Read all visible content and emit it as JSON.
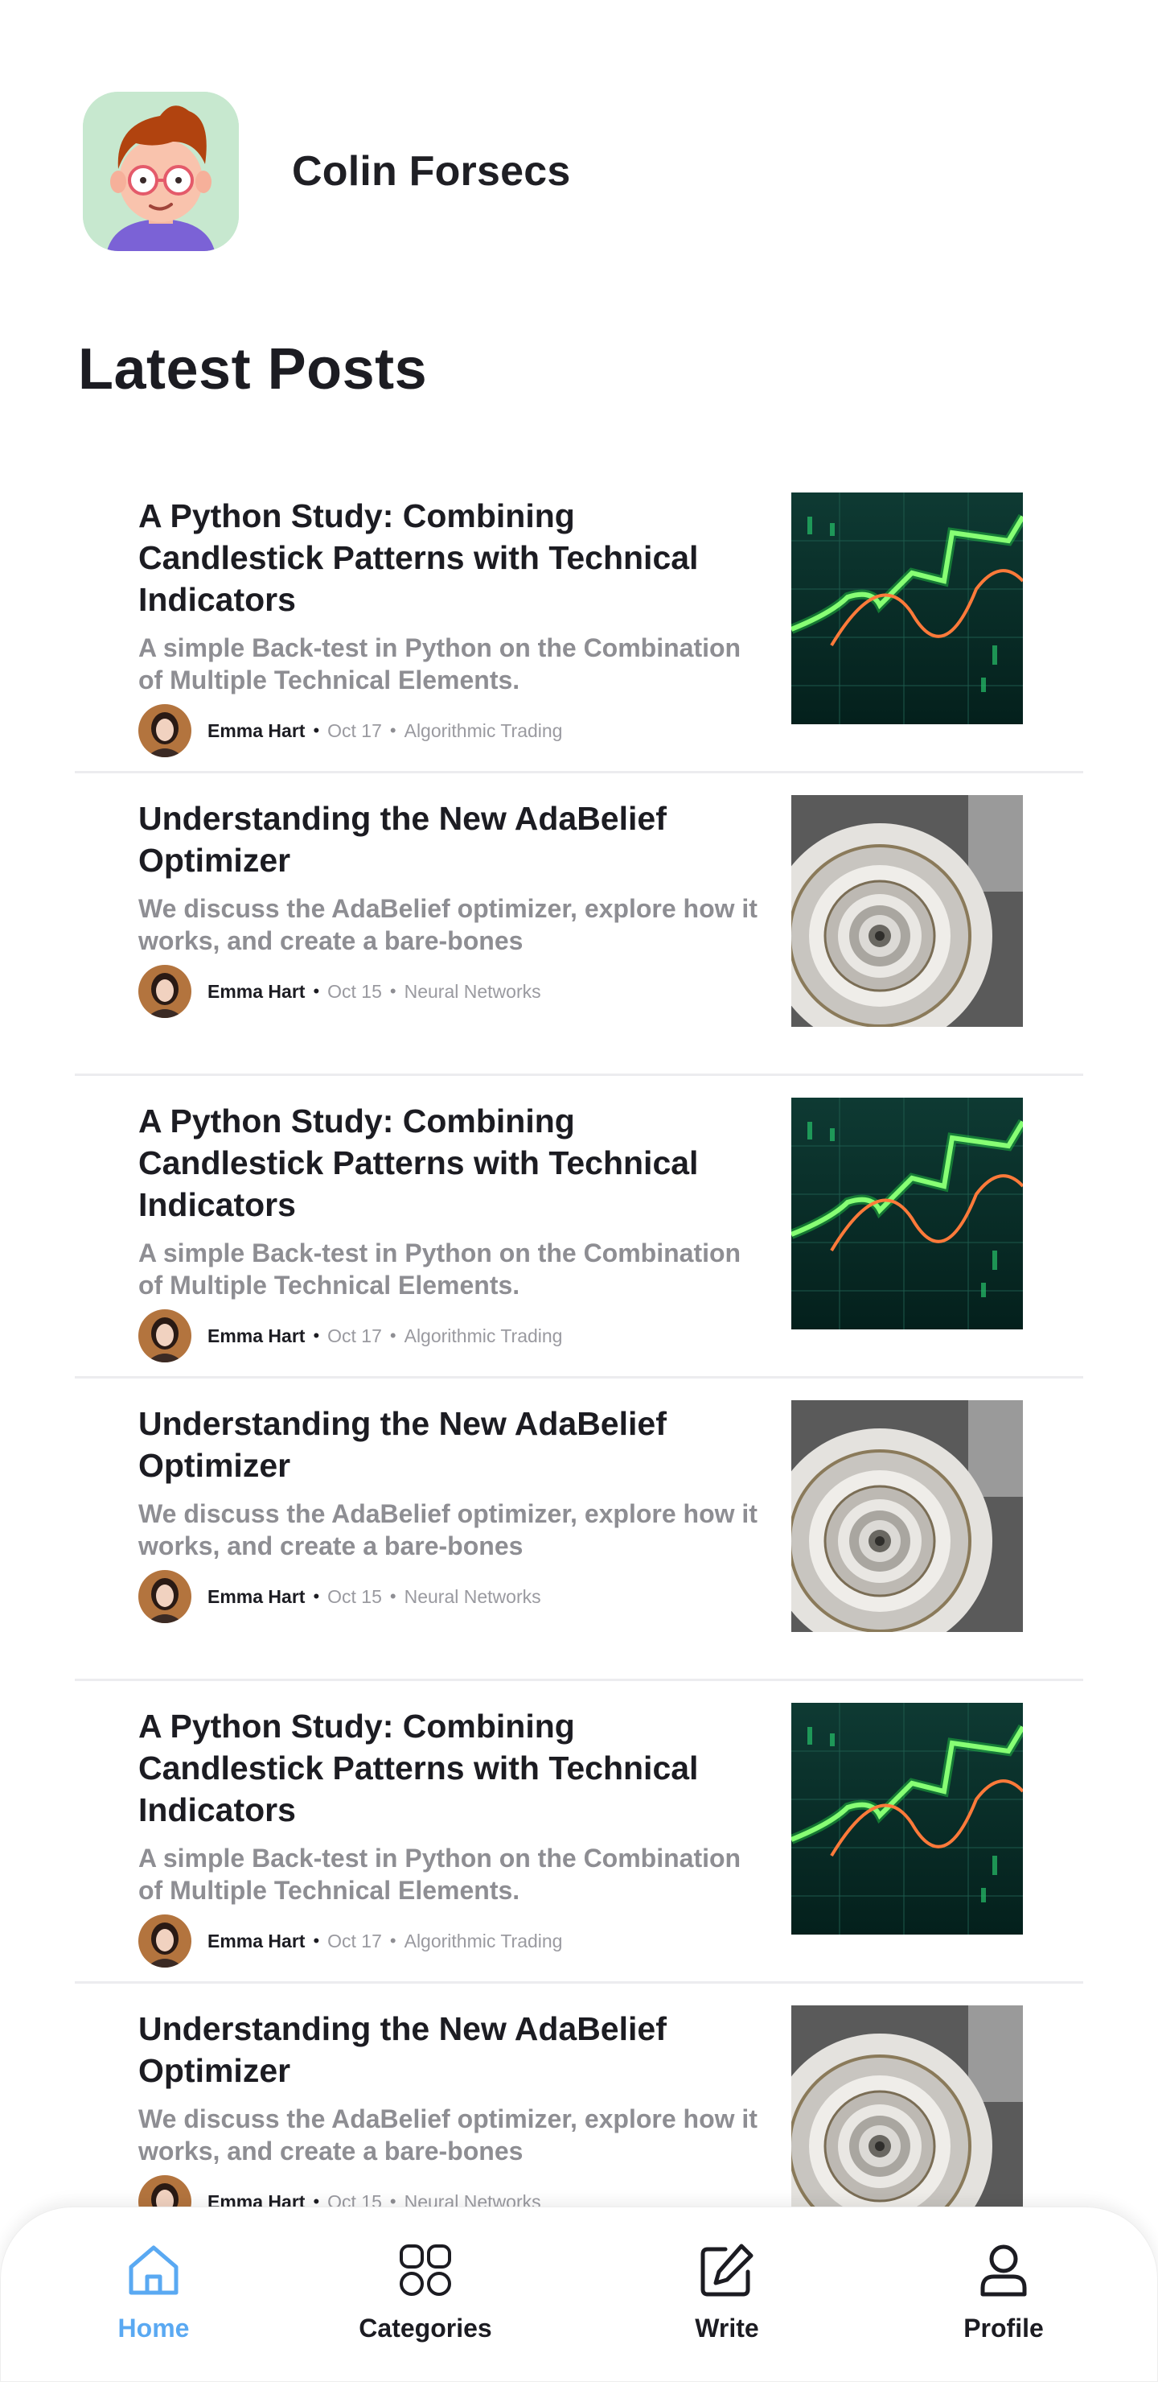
{
  "user": {
    "name": "Colin Forsecs"
  },
  "section_title": "Latest Posts",
  "posts": [
    {
      "title": "A Python Study: Combining Candlestick Patterns with Technical Indicators",
      "subtitle": "A simple Back-test in Python on the Combination of Multiple Technical Elements.",
      "author": "Emma Hart",
      "date": "Oct 17",
      "category": "Algorithmic Trading",
      "thumbnail": "candlestick-chart-image"
    },
    {
      "title": "Understanding the New AdaBelief Optimizer",
      "subtitle": "We discuss the AdaBelief optimizer, explore how it works, and create a bare-bones",
      "author": "Emma Hart",
      "date": "Oct 15",
      "category": "Neural Networks",
      "thumbnail": "spiral-staircase-image"
    },
    {
      "title": "A Python Study: Combining Candlestick Patterns with Technical Indicators",
      "subtitle": "A simple Back-test in Python on the Combination of Multiple Technical Elements.",
      "author": "Emma Hart",
      "date": "Oct 17",
      "category": "Algorithmic Trading",
      "thumbnail": "candlestick-chart-image"
    },
    {
      "title": "Understanding the New AdaBelief Optimizer",
      "subtitle": "We discuss the AdaBelief optimizer, explore how it works, and create a bare-bones",
      "author": "Emma Hart",
      "date": "Oct 15",
      "category": "Neural Networks",
      "thumbnail": "spiral-staircase-image"
    },
    {
      "title": "A Python Study: Combining Candlestick Patterns with Technical Indicators",
      "subtitle": "A simple Back-test in Python on the Combination of Multiple Technical Elements.",
      "author": "Emma Hart",
      "date": "Oct 17",
      "category": "Algorithmic Trading",
      "thumbnail": "candlestick-chart-image"
    },
    {
      "title": "Understanding the New AdaBelief Optimizer",
      "subtitle": "We discuss the AdaBelief optimizer, explore how it works, and create a bare-bones",
      "author": "Emma Hart",
      "date": "Oct 15",
      "category": "Neural Networks",
      "thumbnail": "spiral-staircase-image"
    }
  ],
  "nav": {
    "items": [
      {
        "label": "Home",
        "icon": "home-icon",
        "active": true
      },
      {
        "label": "Categories",
        "icon": "categories-icon",
        "active": false
      },
      {
        "label": "Write",
        "icon": "write-icon",
        "active": false
      },
      {
        "label": "Profile",
        "icon": "profile-icon",
        "active": false
      }
    ]
  },
  "colors": {
    "accent": "#5aa9f2",
    "text": "#1c1c22",
    "muted": "#8e8e93",
    "divider": "#ececef"
  }
}
